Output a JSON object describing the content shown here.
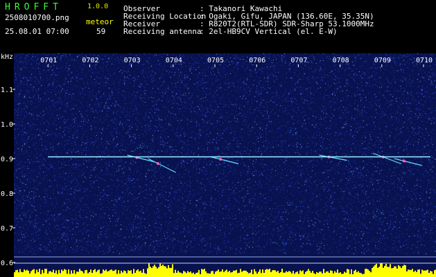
{
  "header": {
    "logo": "HROFFT",
    "version": "1.0.0",
    "filename": "2508010700.png",
    "meteor_label": "meteor",
    "datetime": "25.08.01 07:00",
    "meteor_count": "59"
  },
  "info": [
    {
      "label": "Observer",
      "value": ": Takanori Kawachi"
    },
    {
      "label": "Receiving Location",
      "value": ": Ogaki, Gifu, JAPAN (136.60E, 35.35N)"
    },
    {
      "label": "Receiver",
      "value": ": R820T2(RTL-SDR) SDR-Sharp 53.1000MHz"
    },
    {
      "label": "Receiving antenna",
      "value": ": 2el-HB9CV Vertical (el. E-W)"
    }
  ],
  "colors": {
    "background": "#000000",
    "plot_bg": "#08124f",
    "carrier": "#9cf0ff",
    "level": "#ffff00",
    "logo": "#37ff37"
  },
  "chart_data": {
    "type": "heatmap",
    "ylabel": "kHz",
    "x_ticks": [
      "0701",
      "0702",
      "0703",
      "0704",
      "0705",
      "0706",
      "0707",
      "0708",
      "0709",
      "0710"
    ],
    "y_ticks": [
      "1.1",
      "1.0",
      "0.9",
      "0.8",
      "0.7",
      "0.6"
    ],
    "x_range_minutes": [
      0,
      10
    ],
    "y_range_khz": [
      0.59,
      1.19
    ],
    "carrier_khz": 0.905,
    "meteor_echoes": [
      {
        "minute": 2.9,
        "khz_start": 0.91,
        "khz_end": 0.89
      },
      {
        "minute": 3.4,
        "khz_start": 0.9,
        "khz_end": 0.86
      },
      {
        "minute": 4.9,
        "khz_start": 0.905,
        "khz_end": 0.885
      },
      {
        "minute": 7.5,
        "khz_start": 0.91,
        "khz_end": 0.895
      },
      {
        "minute": 8.8,
        "khz_start": 0.915,
        "khz_end": 0.885
      },
      {
        "minute": 9.3,
        "khz_start": 0.9,
        "khz_end": 0.88
      }
    ]
  }
}
